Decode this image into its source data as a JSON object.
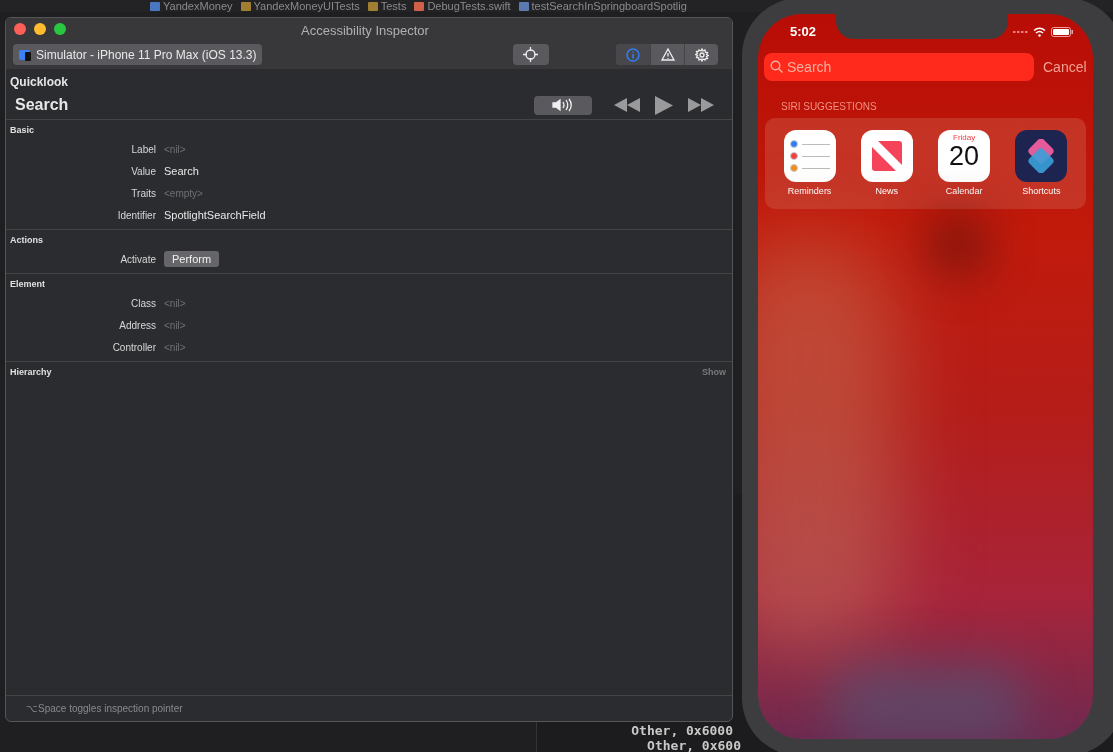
{
  "xcode": {
    "breadcrumbs": [
      {
        "kind": "project",
        "label": "YandexMoney"
      },
      {
        "kind": "folder",
        "label": "YandexMoneyUITests"
      },
      {
        "kind": "folder",
        "label": "Tests"
      },
      {
        "kind": "swift",
        "label": "DebugTests.swift"
      },
      {
        "kind": "method",
        "label": "testSearchInSpringboardSpotlig"
      }
    ],
    "console_lines": [
      "Other, 0x6000",
      "Other, 0x600"
    ]
  },
  "inspector": {
    "title": "Accessibility Inspector",
    "device": "Simulator - iPhone 11 Pro Max (iOS 13.3)",
    "tabs": [
      {
        "kind": "info",
        "selected": true
      },
      {
        "kind": "warning",
        "selected": false
      },
      {
        "kind": "settings",
        "selected": false
      }
    ],
    "quicklook": {
      "heading": "Quicklook",
      "value": "Search"
    },
    "sections": [
      {
        "title": "Basic",
        "rows": [
          {
            "label": "Label",
            "kind": "empty",
            "value": "<nil>"
          },
          {
            "label": "Value",
            "kind": "text",
            "value": "Search"
          },
          {
            "label": "Traits",
            "kind": "empty",
            "value": "<empty>"
          },
          {
            "label": "Identifier",
            "kind": "text",
            "value": "SpotlightSearchField"
          }
        ]
      },
      {
        "title": "Actions",
        "rows": [
          {
            "label": "Activate",
            "kind": "button",
            "value": "Perform"
          }
        ]
      },
      {
        "title": "Element",
        "rows": [
          {
            "label": "Class",
            "kind": "empty",
            "value": "<nil>"
          },
          {
            "label": "Address",
            "kind": "empty",
            "value": "<nil>"
          },
          {
            "label": "Controller",
            "kind": "empty",
            "value": "<nil>"
          }
        ]
      },
      {
        "title": "Hierarchy",
        "action": "Show"
      }
    ],
    "footer": "⌥Space toggles inspection pointer"
  },
  "phone": {
    "time": "5:02",
    "search": {
      "placeholder": "Search"
    },
    "cancel": "Cancel",
    "suggestions_title": "SIRI SUGGESTIONS",
    "apps": [
      {
        "kind": "reminders",
        "name": "Reminders"
      },
      {
        "kind": "news",
        "name": "News"
      },
      {
        "kind": "calendar",
        "name": "Calendar",
        "weekday": "Friday",
        "day": "20"
      },
      {
        "kind": "shortcuts",
        "name": "Shortcuts"
      }
    ]
  }
}
